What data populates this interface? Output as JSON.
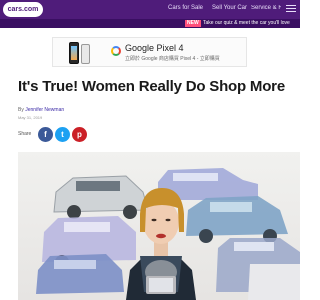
{
  "header": {
    "logo_text": "cars.com",
    "nav": [
      "Cars for Sale",
      "Sell Your Car",
      "Service & Repair"
    ],
    "promo_badge": "NEW",
    "promo_text": "Take our quiz & meet the car you'll love",
    "colors": {
      "nav_bg": "#4f1c7a",
      "promo_bg": "#3a0f62",
      "badge": "#ff4f7b"
    }
  },
  "ad": {
    "title": "Google Pixel 4",
    "subtitle": "立即於 Google 商店購買 Pixel 4 - 立即購買"
  },
  "article": {
    "title": "It's True! Women Really Do Shop More",
    "byline_prefix": "By",
    "author": "Jennifer Newman",
    "date": "May 31, 2019",
    "share_label": "Share",
    "share_buttons": [
      {
        "icon": "facebook-icon",
        "glyph": "f",
        "color": "#3b5998"
      },
      {
        "icon": "twitter-icon",
        "glyph": "t",
        "color": "#1da1f2"
      },
      {
        "icon": "pinterest-icon",
        "glyph": "p",
        "color": "#cb2027"
      }
    ]
  }
}
